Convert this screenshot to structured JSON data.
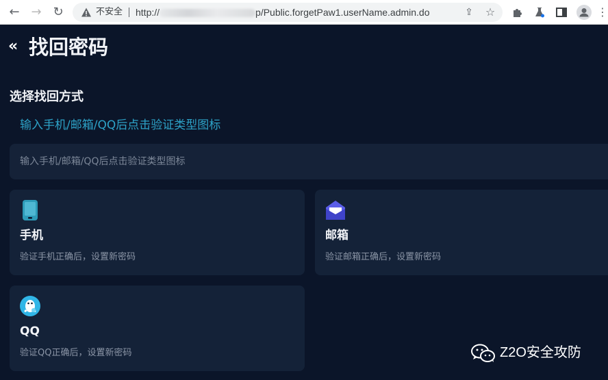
{
  "browser": {
    "insecure_label": "不安全",
    "url_prefix": "http://",
    "url_suffix": "p/Public.forgetPaw1.userName.admin.do"
  },
  "page": {
    "title": "找回密码",
    "section_title": "选择找回方式",
    "hint_link": "输入手机/邮箱/QQ后点击验证类型图标",
    "account_input": {
      "placeholder": "输入手机/邮箱/QQ后点击验证类型图标",
      "value": ""
    },
    "methods": [
      {
        "label": "手机",
        "desc": "验证手机正确后，设置新密码",
        "icon": "phone-icon",
        "color": "#2d9bb8"
      },
      {
        "label": "邮箱",
        "desc": "验证邮箱正确后，设置新密码",
        "icon": "envelope-icon",
        "color": "#5b5ee8"
      },
      {
        "label": "QQ",
        "desc": "验证QQ正确后，设置新密码",
        "icon": "qq-penguin-icon",
        "color": "#31b6e7"
      }
    ]
  },
  "watermark": {
    "text": "Z2O安全攻防"
  },
  "colors": {
    "page_bg": "#0b1529",
    "card_bg": "#142238",
    "accent_link": "#2da2c7"
  }
}
